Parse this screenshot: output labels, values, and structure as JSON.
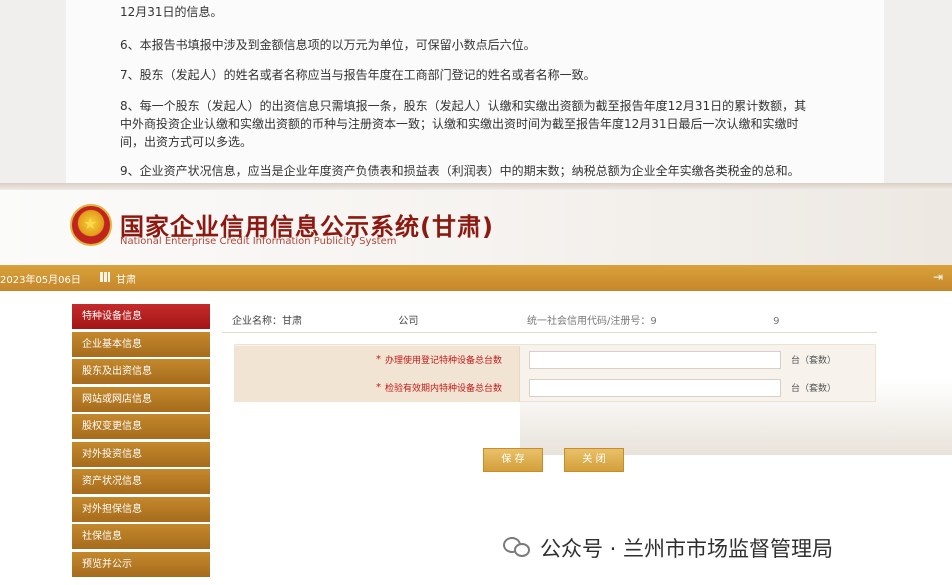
{
  "document": {
    "lines": [
      "12月31日的信息。",
      "6、本报告书填报中涉及到金额信息项的以万元为单位，可保留小数点后六位。",
      "7、股东（发起人）的姓名或者名称应当与报告年度在工商部门登记的姓名或者名称一致。",
      "8、每一个股东（发起人）的出资信息只需填报一条，股东（发起人）认缴和实缴出资额为截至报告年度12月31日的累计数额，其",
      "中外商投资企业认缴和实缴出资额的币种与注册资本一致；认缴和实缴出资时间为截至报告年度12月31日最后一次认缴和实缴时",
      "间，出资方式可以多选。",
      "9、企业资产状况信息，应当是企业年度资产负债表和损益表（利润表）中的期末数；纳税总额为企业全年实缴各类税金的总和。"
    ]
  },
  "banner": {
    "title": "国家企业信用信息公示系统(甘肃)",
    "subtitle": "National Enterprise Credit Information Publicity System",
    "emblem_icon": "national-emblem-icon"
  },
  "nav": {
    "date": "2023年05月06日",
    "user": "甘肃",
    "logout_icon": "logout-icon"
  },
  "sidebar": {
    "items": [
      {
        "label": "特种设备信息",
        "active": true
      },
      {
        "label": "企业基本信息"
      },
      {
        "label": "股东及出资信息"
      },
      {
        "label": "网站或网店信息"
      },
      {
        "label": "股权变更信息"
      },
      {
        "label": "对外投资信息"
      },
      {
        "label": "资产状况信息"
      },
      {
        "label": "对外担保信息"
      },
      {
        "label": "社保信息"
      },
      {
        "label": "预览并公示"
      }
    ]
  },
  "main": {
    "company_label": "企业名称：甘肃",
    "company_suffix": "公司",
    "credit_label": "统一社会信用代码/注册号：9",
    "credit_tail": "9",
    "rows": [
      {
        "required": "*",
        "label": "办理使用登记特种设备总台数",
        "value": "",
        "unit": "台（套数）"
      },
      {
        "required": "*",
        "label": "检验有效期内特种设备总台数",
        "value": "",
        "unit": "台（套数）"
      }
    ],
    "save_label": "保 存",
    "close_label": "关 闭"
  },
  "watermark": {
    "text": "公众号 · 兰州市市场监督管理局",
    "icon": "wechat-icon"
  },
  "colors": {
    "accent": "#8c1810",
    "nav": "#c6862a",
    "sidebar": "#b07622",
    "active": "#b61d1d"
  }
}
